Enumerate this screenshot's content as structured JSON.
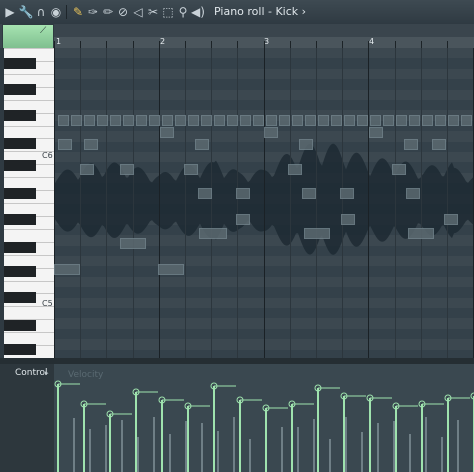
{
  "toolbar": {
    "icons": [
      "wrench-icon",
      "headphones-icon",
      "record-icon",
      "pencil-icon",
      "brush-icon",
      "paint-icon",
      "delete-icon",
      "mute-icon",
      "slice-icon",
      "select-icon",
      "zoom-icon",
      "speaker-icon"
    ],
    "title": "Piano roll - Kick",
    "title_arrow": "›"
  },
  "ruler": {
    "bars": [
      "1",
      "2",
      "3",
      "4"
    ]
  },
  "keys": {
    "labels": [
      "C6",
      "C5"
    ]
  },
  "control": {
    "label": "Control",
    "watermark": "Velocity"
  },
  "colors": {
    "accent": "#8fd19e",
    "grid": "#3c4850",
    "note": "#5b6970",
    "velocity": "#9fe3ae"
  }
}
